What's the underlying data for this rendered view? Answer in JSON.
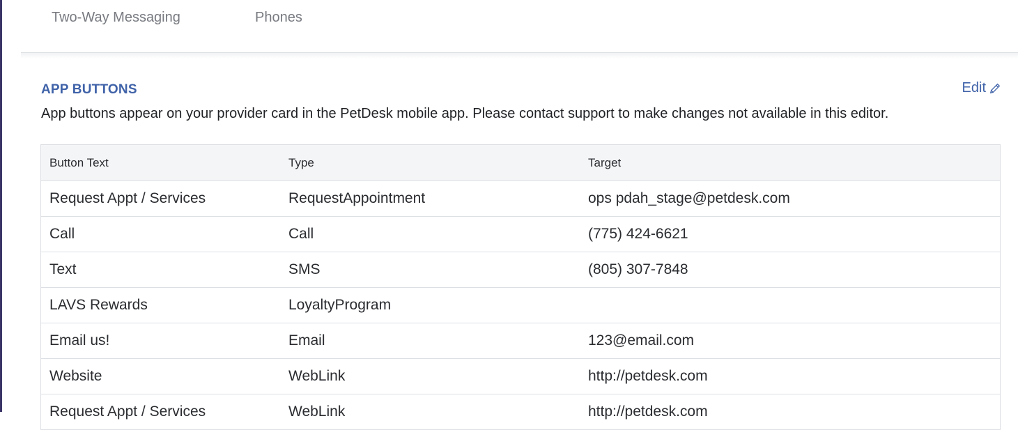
{
  "tabs": [
    {
      "label": "Two-Way Messaging"
    },
    {
      "label": "Phones"
    }
  ],
  "app_buttons": {
    "title": "APP BUTTONS",
    "edit_label": "Edit",
    "description": "App buttons appear on your provider card in the PetDesk mobile app. Please contact support to make changes not available in this editor.",
    "columns": [
      "Button Text",
      "Type",
      "Target"
    ],
    "rows": [
      {
        "button_text": "Request Appt / Services",
        "type": "RequestAppointment",
        "target": "ops pdah_stage@petdesk.com"
      },
      {
        "button_text": "Call",
        "type": "Call",
        "target": "(775) 424-6621"
      },
      {
        "button_text": "Text",
        "type": "SMS",
        "target": "(805) 307-7848"
      },
      {
        "button_text": "LAVS Rewards",
        "type": "LoyaltyProgram",
        "target": ""
      },
      {
        "button_text": "Email us!",
        "type": "Email",
        "target": "123@email.com"
      },
      {
        "button_text": "Website",
        "type": "WebLink",
        "target": "http://petdesk.com"
      },
      {
        "button_text": "Request Appt / Services",
        "type": "WebLink",
        "target": "http://petdesk.com"
      }
    ]
  },
  "icons": {
    "edit": "pencil-icon"
  },
  "colors": {
    "accent": "#3f62a8",
    "rail": "#3a3566",
    "tab_text": "#777a80",
    "header_bg": "#f4f5f7",
    "border": "#dcdfe3"
  }
}
